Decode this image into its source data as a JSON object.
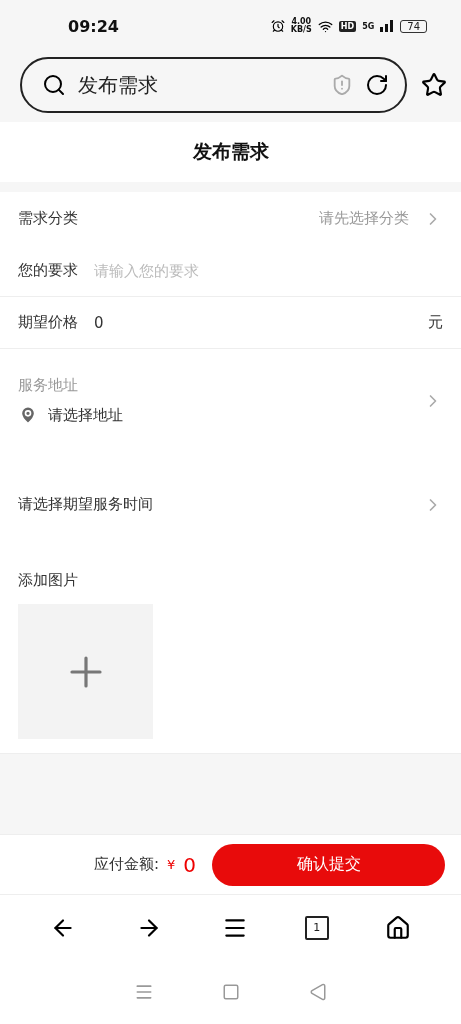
{
  "status_bar": {
    "time": "09:24",
    "speed": "4.00",
    "speed_unit": "KB/S",
    "hd": "HD",
    "network": "5G",
    "battery": "74"
  },
  "address_bar": {
    "value": "发布需求"
  },
  "page_title": "发布需求",
  "form": {
    "category": {
      "label": "需求分类",
      "placeholder": "请先选择分类"
    },
    "requirement": {
      "label": "您的要求",
      "placeholder": "请输入您的要求"
    },
    "price": {
      "label": "期望价格",
      "value": "0",
      "unit": "元"
    },
    "address": {
      "label": "服务地址",
      "placeholder": "请选择地址"
    },
    "time": {
      "placeholder": "请选择期望服务时间"
    },
    "images": {
      "label": "添加图片"
    }
  },
  "footer": {
    "amount_label": "应付金额:",
    "currency": "¥",
    "amount": "0",
    "submit": "确认提交"
  },
  "browser_nav": {
    "tab_count": "1"
  }
}
